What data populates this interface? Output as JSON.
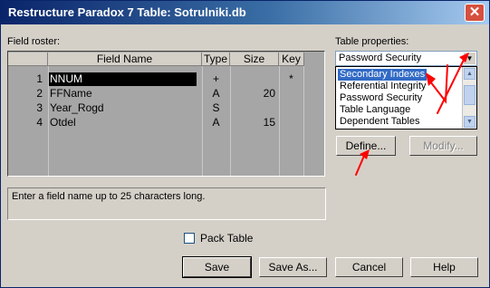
{
  "window": {
    "title": "Restructure Paradox 7 Table: Sotrulniki.db",
    "close_glyph": "✕"
  },
  "field_roster": {
    "label": "Field roster:",
    "columns": [
      "Field Name",
      "Type",
      "Size",
      "Key"
    ],
    "rows": [
      {
        "num": "1",
        "name": "NNUM",
        "type": "+",
        "size": "",
        "key": "*"
      },
      {
        "num": "2",
        "name": "FFName",
        "type": "A",
        "size": "20",
        "key": ""
      },
      {
        "num": "3",
        "name": "Year_Rogd",
        "type": "S",
        "size": "",
        "key": ""
      },
      {
        "num": "4",
        "name": "Otdel",
        "type": "A",
        "size": "15",
        "key": ""
      }
    ]
  },
  "description": "Enter a field name up to 25 characters long.",
  "table_properties": {
    "label": "Table properties:",
    "selected": "Password Security",
    "options": [
      "Secondary Indexes",
      "Referential Integrity",
      "Password Security",
      "Table Language",
      "Dependent Tables"
    ],
    "highlighted": "Secondary Indexes"
  },
  "buttons": {
    "define": "Define...",
    "modify": "Modify...",
    "save": "Save",
    "save_as": "Save As...",
    "cancel": "Cancel",
    "help": "Help"
  },
  "pack_table": {
    "label": "Pack Table",
    "checked": false
  },
  "colors": {
    "title_bar": "#0a246a",
    "highlight": "#316ac5",
    "annotation_arrow": "#ff0000",
    "grid_bg": "#a6a6a6"
  }
}
